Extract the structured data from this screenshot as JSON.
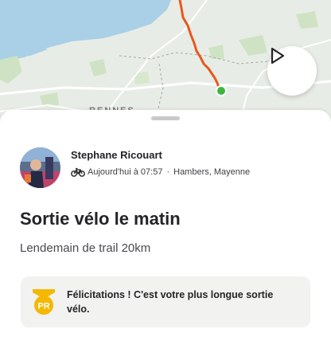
{
  "map": {
    "city_label": "RENNES",
    "route_color": "#e8581c",
    "end_marker_color": "#3fb43f"
  },
  "replay_button": {
    "icon": "play-icon"
  },
  "activity": {
    "athlete_name": "Stephane Ricouart",
    "sport_icon": "bike-icon",
    "date_time": "Aujourd'hui à 07:57",
    "separator": "·",
    "location": "Hambers, Mayenne",
    "title": "Sortie vélo le matin",
    "description": "Lendemain de trail 20km"
  },
  "achievement": {
    "badge_text": "PR",
    "badge_color": "#f5b700",
    "message": "Félicitations ! C'est votre plus longue sortie vélo."
  }
}
